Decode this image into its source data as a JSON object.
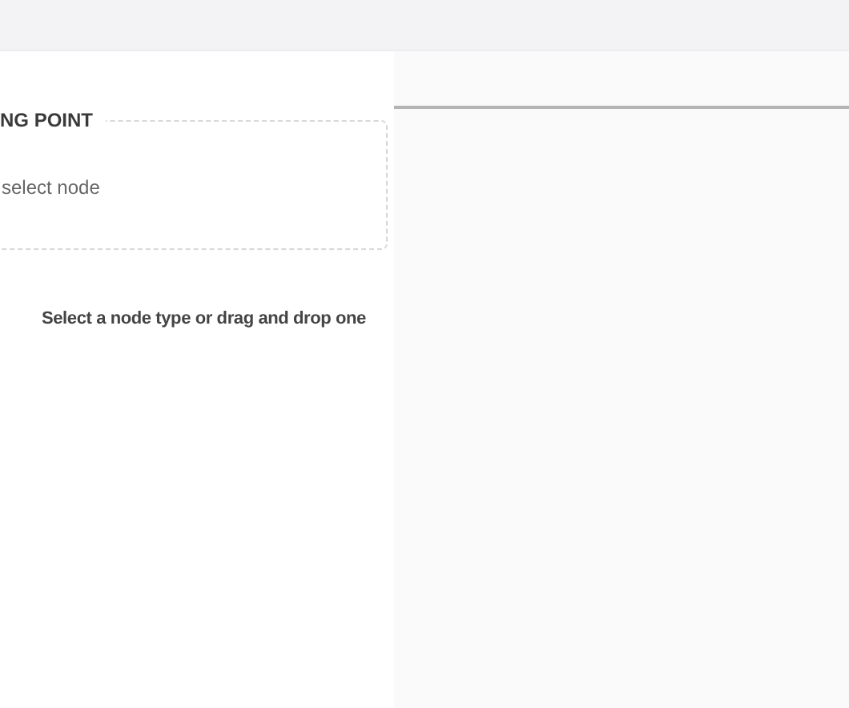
{
  "panel": {
    "legend": "NG POINT",
    "placeholder": "select node"
  },
  "message": "Select a node type or drag and drop one"
}
